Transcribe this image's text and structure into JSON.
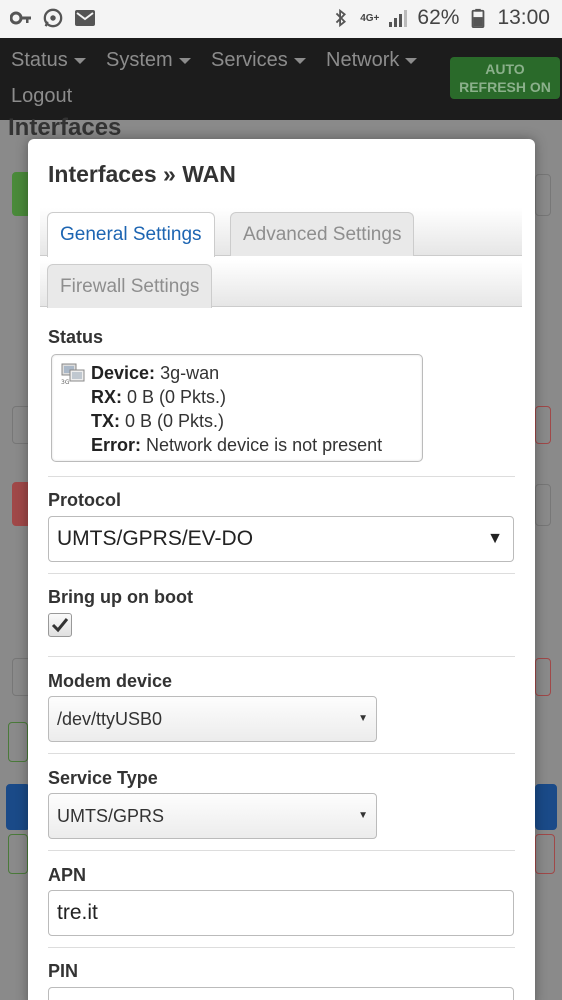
{
  "statusbar": {
    "battery": "62%",
    "time": "13:00",
    "network": "4G+"
  },
  "nav": {
    "items": [
      "Status",
      "System",
      "Services",
      "Network"
    ],
    "logout": "Logout",
    "auto_refresh_line1": "AUTO",
    "auto_refresh_line2": "REFRESH ON"
  },
  "background": {
    "title": "Interfaces"
  },
  "modal": {
    "title": "Interfaces » WAN",
    "tabs": [
      "General Settings",
      "Advanced Settings",
      "Firewall Settings"
    ],
    "active_tab": "General Settings",
    "status": {
      "label": "Status",
      "device_label": "Device:",
      "device_value": "3g-wan",
      "rx_label": "RX:",
      "rx_value": "0 B (0 Pkts.)",
      "tx_label": "TX:",
      "tx_value": "0 B (0 Pkts.)",
      "error_label": "Error:",
      "error_value": "Network device is not present"
    },
    "protocol": {
      "label": "Protocol",
      "value": "UMTS/GPRS/EV-DO"
    },
    "boot": {
      "label": "Bring up on boot",
      "checked": true
    },
    "modem": {
      "label": "Modem device",
      "value": "/dev/ttyUSB0"
    },
    "service": {
      "label": "Service Type",
      "value": "UMTS/GPRS"
    },
    "apn": {
      "label": "APN",
      "value": "tre.it"
    },
    "pin": {
      "label": "PIN",
      "value": ""
    }
  },
  "colors": {
    "active_tab": "#1d65b2",
    "auto_refresh": "#2a6a2a"
  }
}
